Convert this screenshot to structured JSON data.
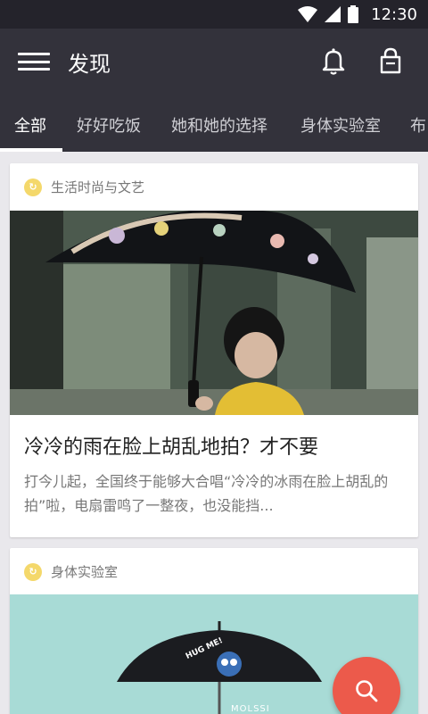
{
  "status_bar": {
    "time": "12:30"
  },
  "app_bar": {
    "title": "发现"
  },
  "tabs": [
    {
      "label": "全部",
      "active": true
    },
    {
      "label": "好好吃饭",
      "active": false
    },
    {
      "label": "她和她的选择",
      "active": false
    },
    {
      "label": "身体实验室",
      "active": false
    },
    {
      "label": "布",
      "active": false
    }
  ],
  "feed": [
    {
      "category": "生活时尚与文艺",
      "title": "冷冷的雨在脸上胡乱地拍？才不要",
      "summary": "打今儿起，全国终于能够大合唱“冷冷的冰雨在脸上胡乱的拍”啦，电扇雷鸣了一整夜，也没能挡..."
    },
    {
      "category": "身体实验室",
      "image_text_1": "HUG ME!",
      "image_text_2": "MOLSSI"
    }
  ],
  "colors": {
    "status_bar": "#24232b",
    "app_bar": "#33323b",
    "background": "#e9e8ec",
    "category_icon": "#f4d86b",
    "fab": "#ec5a4b",
    "card2_image_bg": "#a8dbd6"
  },
  "icons": {
    "menu": "menu-icon",
    "bell": "bell-icon",
    "bag": "shopping-bag-icon",
    "fab": "search-icon"
  }
}
